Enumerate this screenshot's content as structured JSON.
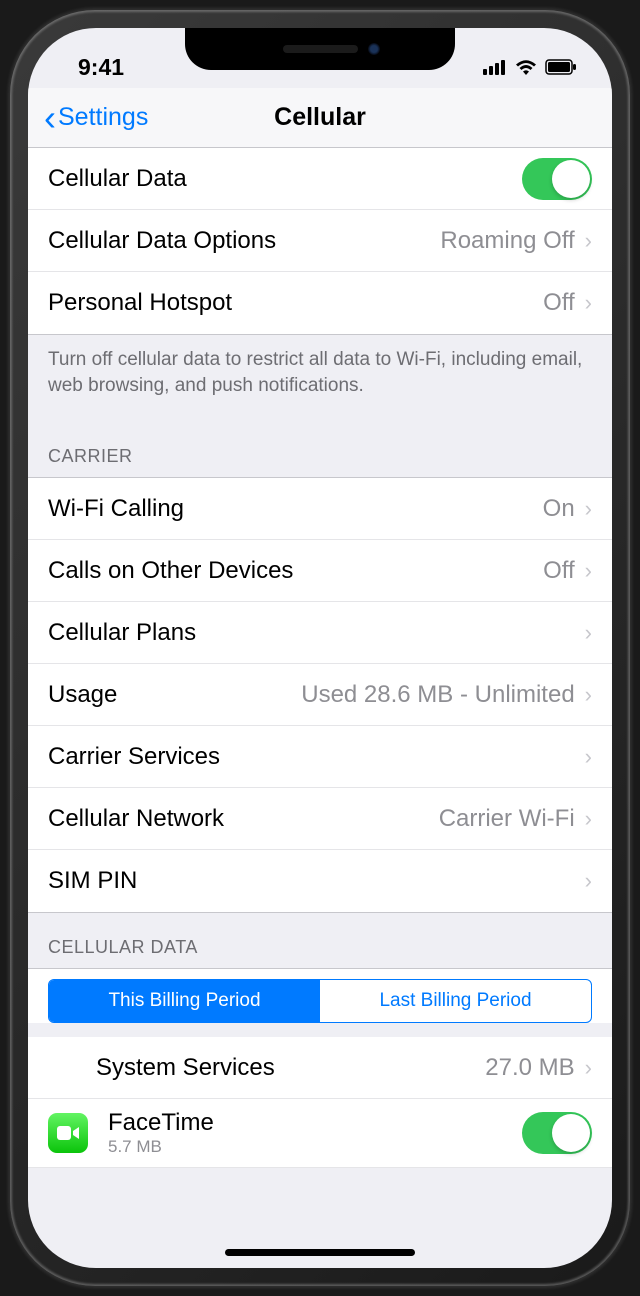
{
  "status": {
    "time": "9:41"
  },
  "nav": {
    "back": "Settings",
    "title": "Cellular"
  },
  "mainRows": {
    "cellularData": "Cellular Data",
    "cellularDataOptions": "Cellular Data Options",
    "cellularDataOptionsValue": "Roaming Off",
    "personalHotspot": "Personal Hotspot",
    "personalHotspotValue": "Off"
  },
  "footer": "Turn off cellular data to restrict all data to Wi-Fi, including email, web browsing, and push notifications.",
  "carrier": {
    "header": "CARRIER",
    "wifiCalling": "Wi-Fi Calling",
    "wifiCallingValue": "On",
    "callsOther": "Calls on Other Devices",
    "callsOtherValue": "Off",
    "cellularPlans": "Cellular Plans",
    "usage": "Usage",
    "usageValue": "Used 28.6 MB - Unlimited",
    "carrierServices": "Carrier Services",
    "cellularNetwork": "Cellular Network",
    "cellularNetworkValue": "Carrier Wi-Fi",
    "simPin": "SIM PIN"
  },
  "cellularDataSection": {
    "header": "CELLULAR DATA",
    "segment1": "This Billing Period",
    "segment2": "Last Billing Period",
    "systemServices": "System Services",
    "systemServicesValue": "27.0 MB",
    "facetime": "FaceTime",
    "facetimeSub": "5.7 MB"
  }
}
